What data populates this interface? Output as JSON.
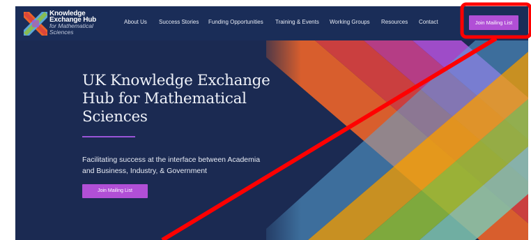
{
  "brand": {
    "line1": "Knowledge",
    "line2": "Exchange Hub",
    "line3": "for Mathematical",
    "line4": "Sciences",
    "logo_icon": "kehub-x-logo-icon"
  },
  "nav": {
    "items": [
      {
        "label": "About Us"
      },
      {
        "label": "Success Stories"
      },
      {
        "label": "Funding Opportunities"
      },
      {
        "label": "Training & Events"
      },
      {
        "label": "Working Groups"
      },
      {
        "label": "Resources"
      },
      {
        "label": "Contact"
      }
    ],
    "cta_label": "Join Mailing List"
  },
  "hero": {
    "title": "UK Knowledge Exchange Hub for Mathematical Sciences",
    "subtitle": "Facilitating success at the interface between Academia and Business, Industry, & Government",
    "cta_label": "Join Mailing List"
  },
  "colors": {
    "nav_background": "#1a2d58",
    "hero_background": "#1b2a52",
    "button_purple": "#b14fd6",
    "annotation_red": "#ff0000",
    "stripes": [
      "#e8632a",
      "#d9413e",
      "#c23f8a",
      "#a94fd3",
      "#5aa6d9",
      "#7fc6b0",
      "#8fbf3a",
      "#e6a21a"
    ]
  }
}
